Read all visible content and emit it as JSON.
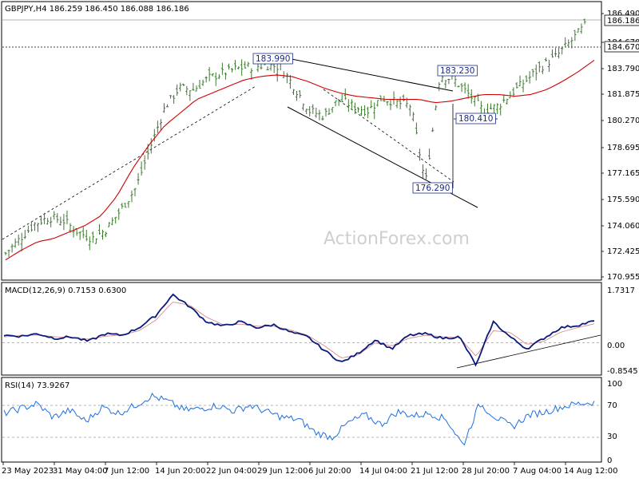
{
  "main": {
    "header": "GBPJPY,H4  186.259 186.450 186.088 186.186",
    "price_axis_labels": [
      "186.490",
      "184.670",
      "183.790",
      "181.875",
      "180.270",
      "178.695",
      "177.165",
      "175.590",
      "174.060",
      "172.425",
      "170.955"
    ],
    "current_price_tag": "186.186",
    "hline_price_tag": "184.670",
    "swing_labels": [
      "183.990",
      "183.230",
      "180.410",
      "176.290"
    ],
    "watermark": "ActionForex.com"
  },
  "macd": {
    "header": "MACD(12,26,9) 0.7153 0.6300",
    "axis_labels": [
      "1.7317",
      "0.00",
      "-0.8545"
    ]
  },
  "rsi": {
    "header": "RSI(14) 73.9267",
    "axis_labels": [
      "100",
      "70",
      "30",
      "0"
    ]
  },
  "date_labels": [
    "23 May 2023",
    "31 May 04:00",
    "7 Jun 12:00",
    "14 Jun 20:00",
    "22 Jun 04:00",
    "29 Jun 12:00",
    "6 Jul 20:00",
    "14 Jul 04:00",
    "21 Jul 12:00",
    "28 Jul 20:00",
    "7 Aug 04:00",
    "14 Aug 12:00"
  ],
  "colors": {
    "bars": "#3c7a2f",
    "ma": "#d10000",
    "macd_line": "#0a1a7a",
    "signal_line": "#d38b8b",
    "rsi_line": "#1f6fe0",
    "trendline": "#000000",
    "grid_dash": "#9a9a9a"
  },
  "chart_data": [
    {
      "type": "line",
      "title": "GBPJPY,H4",
      "panel": "price",
      "header_values": {
        "open": 186.259,
        "high": 186.45,
        "low": 186.088,
        "close": 186.186
      },
      "x_categories": [
        "23 May 2023",
        "31 May 04:00",
        "7 Jun 12:00",
        "14 Jun 20:00",
        "22 Jun 04:00",
        "29 Jun 12:00",
        "6 Jul 20:00",
        "14 Jul 04:00",
        "21 Jul 12:00",
        "28 Jul 20:00",
        "7 Aug 04:00",
        "14 Aug 12:00"
      ],
      "ylim": [
        170.955,
        186.9
      ],
      "series": [
        {
          "values": [
            172.3,
            173.2,
            174.1,
            174.5,
            174.3,
            173.6,
            173.2,
            173.8,
            175.0,
            176.3,
            178.8,
            181.2,
            182.4,
            182.3,
            183.0,
            183.3,
            183.6,
            183.7,
            183.8,
            183.7,
            182.4,
            181.0,
            180.7,
            181.7,
            181.3,
            181.0,
            181.8,
            181.5,
            181.3,
            176.5,
            183.2,
            182.9,
            182.0,
            181.0,
            181.3,
            182.1,
            182.9,
            183.7,
            184.3,
            185.2,
            186.19
          ]
        },
        {
          "values": [
            171.9,
            172.5,
            173.0,
            173.2,
            173.6,
            174.0,
            174.6,
            175.8,
            177.5,
            178.9,
            180.1,
            180.9,
            181.7,
            182.1,
            182.5,
            182.9,
            183.1,
            183.2,
            183.1,
            182.8,
            182.4,
            182.1,
            181.9,
            181.8,
            181.7,
            181.7,
            181.7,
            181.5,
            181.6,
            181.8,
            182.0,
            182.0,
            181.9,
            182.0,
            182.3,
            182.8,
            183.4,
            184.1
          ]
        }
      ],
      "annotations": [
        {
          "label": "183.990",
          "value": 183.99
        },
        {
          "label": "183.230",
          "value": 183.23
        },
        {
          "label": "180.410",
          "value": 180.41
        },
        {
          "label": "176.290",
          "value": 176.29
        }
      ],
      "horizontal_lines": [
        186.186,
        184.67
      ]
    },
    {
      "type": "line",
      "title": "MACD(12,26,9)",
      "panel": "macd",
      "header_values": [
        0.7153,
        0.63
      ],
      "ylim": [
        -0.8545,
        1.7317
      ],
      "series": [
        {
          "values": [
            0.25,
            0.22,
            0.3,
            0.15,
            0.2,
            0.05,
            0.3,
            0.25,
            0.5,
            0.9,
            1.6,
            1.2,
            0.7,
            0.55,
            0.7,
            0.5,
            0.6,
            0.35,
            0.2,
            -0.25,
            -0.65,
            -0.35,
            0.1,
            -0.2,
            0.25,
            0.3,
            0.15,
            0.2,
            -0.75,
            0.7,
            0.2,
            -0.2,
            0.15,
            0.5,
            0.58,
            0.72
          ]
        },
        {
          "values": [
            0.2,
            0.24,
            0.26,
            0.2,
            0.18,
            0.12,
            0.22,
            0.26,
            0.4,
            0.75,
            1.35,
            1.25,
            0.85,
            0.6,
            0.62,
            0.55,
            0.55,
            0.42,
            0.25,
            -0.1,
            -0.5,
            -0.4,
            0.0,
            -0.1,
            0.15,
            0.25,
            0.2,
            0.18,
            -0.45,
            0.4,
            0.35,
            -0.05,
            0.05,
            0.35,
            0.5,
            0.63
          ]
        }
      ]
    },
    {
      "type": "line",
      "title": "RSI(14)",
      "panel": "rsi",
      "header_values": [
        73.9267
      ],
      "ylim": [
        0,
        100
      ],
      "levels": [
        70,
        30
      ],
      "series": [
        {
          "values": [
            60,
            66,
            72,
            55,
            64,
            50,
            68,
            60,
            70,
            82,
            75,
            64,
            66,
            70,
            63,
            70,
            62,
            55,
            52,
            36,
            30,
            48,
            58,
            46,
            62,
            57,
            60,
            52,
            20,
            72,
            55,
            43,
            58,
            62,
            68,
            72,
            74
          ]
        }
      ]
    }
  ]
}
